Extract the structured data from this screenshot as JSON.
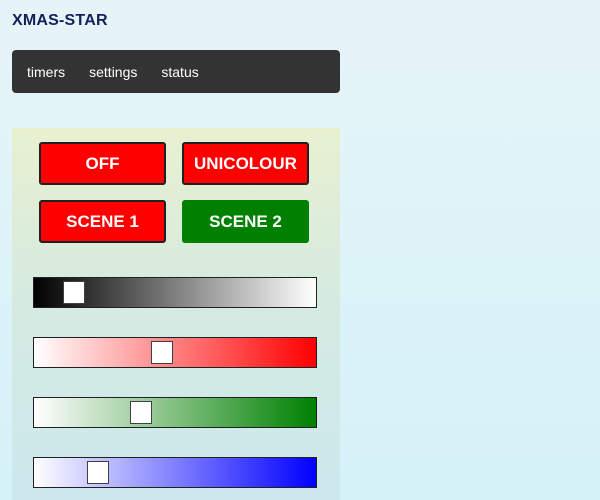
{
  "app": {
    "title": "XMAS-STAR"
  },
  "nav": {
    "items": [
      {
        "label": "timers"
      },
      {
        "label": "settings"
      },
      {
        "label": "status"
      }
    ]
  },
  "buttons": {
    "off": {
      "label": "OFF",
      "color": "#ff0000"
    },
    "unicolour": {
      "label": "UNICOLOUR",
      "color": "#ff0000"
    },
    "scene1": {
      "label": "SCENE 1",
      "color": "#ff0000"
    },
    "scene2": {
      "label": "SCENE 2",
      "color": "#008000"
    }
  },
  "sliders": [
    {
      "name": "brightness-slider",
      "gradient_from": "#000000",
      "gradient_to": "#ffffff",
      "value": 0.11
    },
    {
      "name": "red-slider",
      "gradient_from": "#ffffff",
      "gradient_to": "#ff0000",
      "value": 0.45
    },
    {
      "name": "green-slider",
      "gradient_from": "#ffffff",
      "gradient_to": "#008000",
      "value": 0.37
    },
    {
      "name": "blue-slider",
      "gradient_from": "#ffffff",
      "gradient_to": "#0000ff",
      "value": 0.2
    }
  ]
}
